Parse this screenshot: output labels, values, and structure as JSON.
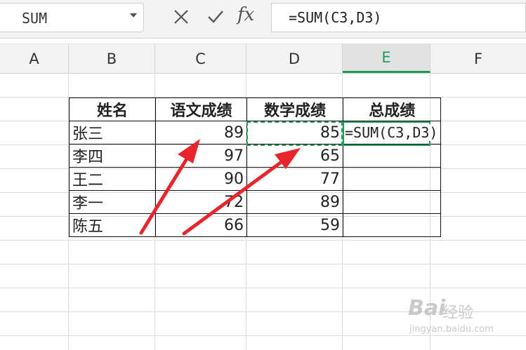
{
  "formula_bar": {
    "name_box": "SUM",
    "fx_label": "fx",
    "formula": "=SUM(C3,D3)"
  },
  "columns": [
    "A",
    "B",
    "C",
    "D",
    "E",
    "F"
  ],
  "active_column": "E",
  "table": {
    "headers": [
      "姓名",
      "语文成绩",
      "数学成绩",
      "总成绩"
    ],
    "rows": [
      {
        "name": "张三",
        "chinese": "89",
        "math": "85",
        "total": "=SUM(C3,D3)"
      },
      {
        "name": "李四",
        "chinese": "97",
        "math": "65",
        "total": ""
      },
      {
        "name": "王二",
        "chinese": "90",
        "math": "77",
        "total": ""
      },
      {
        "name": "李一",
        "chinese": "72",
        "math": "89",
        "total": ""
      },
      {
        "name": "陈五",
        "chinese": "66",
        "math": "59",
        "total": ""
      }
    ]
  },
  "colors": {
    "accent": "#1e9d5a",
    "arrow": "#e8252b"
  },
  "watermark": {
    "name": "Bai",
    "sub": "经验",
    "url": "jingyan.baidu.com"
  }
}
